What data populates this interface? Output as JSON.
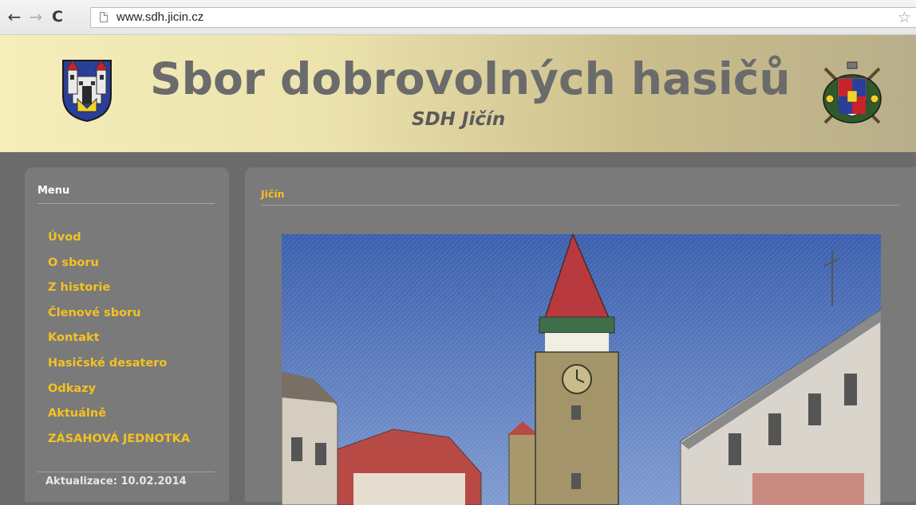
{
  "browser": {
    "url": "www.sdh.jicin.cz"
  },
  "header": {
    "title": "Sbor dobrovolných hasičů",
    "subtitle": "SDH Jičín"
  },
  "sidebar": {
    "title": "Menu",
    "items": [
      {
        "label": "Úvod"
      },
      {
        "label": "O sboru"
      },
      {
        "label": "Z historie"
      },
      {
        "label": "Členové sboru"
      },
      {
        "label": "Kontakt"
      },
      {
        "label": "Hasičské desatero"
      },
      {
        "label": "Odkazy"
      },
      {
        "label": "Aktuálně"
      },
      {
        "label": "ZÁSAHOVÁ JEDNOTKA"
      }
    ],
    "updated": "Aktualizace: 10.02.2014"
  },
  "main": {
    "title": "Jičín"
  },
  "colors": {
    "menu_link": "#f3c222",
    "panel": "#7a7a7a",
    "page_bg": "#6b6b6b",
    "header_light": "#f5eebb",
    "header_dark": "#b8ae8a"
  }
}
